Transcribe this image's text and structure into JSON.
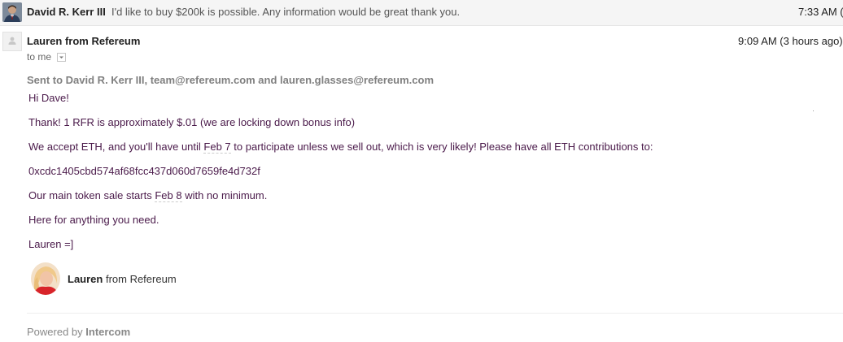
{
  "collapsed_message": {
    "sender": "David R. Kerr III",
    "snippet": "I'd like to buy $200k is possible. Any information would be great thank you.",
    "time": "7:33 AM ("
  },
  "message": {
    "sender": "Lauren from Refereum",
    "time": "9:09 AM (3 hours ago)",
    "to_label": "to me",
    "sent_to": "Sent to David R. Kerr III, team@refereum.com and lauren.glasses@refereum.com",
    "greeting": "Hi Dave!",
    "line1": "Thank! 1 RFR is approximately $.01 (we are locking down bonus info)",
    "line2_a": "We accept ETH, and you'll have until ",
    "line2_date": "Feb 7",
    "line2_b": " to participate unless we sell out, which is very likely!  Please have all ETH contributions to:",
    "address": "0xcdc1405cbd574af68fcc437d060d7659fe4d732f",
    "line4_a": "Our main token sale starts ",
    "line4_date": "Feb 8",
    "line4_b": " with no minimum.",
    "line5": "Here for anything you need.",
    "closing": "Lauren =]"
  },
  "signature": {
    "name": "Lauren",
    "from": " from Refereum"
  },
  "footer": {
    "powered_by": "Powered by ",
    "brand": "Intercom"
  },
  "icons": {
    "collapsed_avatar": "person-photo-icon",
    "sender_avatar": "default-person-icon",
    "dropdown": "chevron-down-icon"
  }
}
